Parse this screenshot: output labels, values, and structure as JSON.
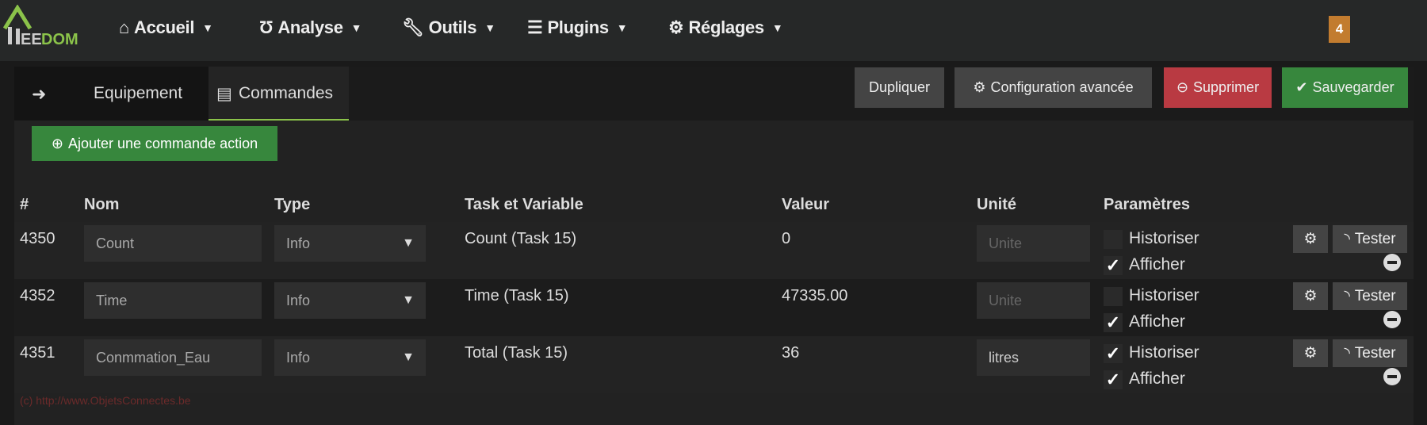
{
  "nav": {
    "logo_text": "EEDOM",
    "items": [
      {
        "label": "Accueil",
        "icon": "home-icon"
      },
      {
        "label": "Analyse",
        "icon": "stethoscope-icon"
      },
      {
        "label": "Outils",
        "icon": "wrench-icon"
      },
      {
        "label": "Plugins",
        "icon": "tasks-icon"
      },
      {
        "label": "Réglages",
        "icon": "cog-icon"
      }
    ],
    "badge": "4"
  },
  "tabs": {
    "back_icon": "arrow-circle-left-icon",
    "equipement": "Equipement",
    "commandes": "Commandes"
  },
  "actions": {
    "dupliquer": "Dupliquer",
    "config": "Configuration avancée",
    "supprimer": "Supprimer",
    "sauvegarder": "Sauvegarder"
  },
  "add_command": "Ajouter une commande action",
  "table": {
    "headers": [
      "#",
      "Nom",
      "Type",
      "Task et Variable",
      "Valeur",
      "Unité",
      "Paramètres"
    ],
    "rows": [
      {
        "id": "4350",
        "name": "Count",
        "type": "Info",
        "task": "Count (Task 15)",
        "value": "0",
        "unit": "",
        "unit_placeholder": "Unite",
        "historiser": false,
        "afficher": true
      },
      {
        "id": "4352",
        "name": "Time",
        "type": "Info",
        "task": "Time (Task 15)",
        "value": "47335.00",
        "unit": "",
        "unit_placeholder": "Unite",
        "historiser": false,
        "afficher": true
      },
      {
        "id": "4351",
        "name": "Conmmation_Eau",
        "type": "Info",
        "task": "Total (Task 15)",
        "value": "36",
        "unit": "litres",
        "unit_placeholder": "Unite",
        "historiser": true,
        "afficher": true
      }
    ],
    "historiser_label": "Historiser",
    "afficher_label": "Afficher",
    "tester_label": "Tester"
  },
  "watermark": "(c) http://www.ObjetsConnectes.be",
  "colors": {
    "accent": "#8bc34a",
    "success": "#37873d",
    "danger": "#b93a42",
    "badge": "#c27c2f"
  }
}
